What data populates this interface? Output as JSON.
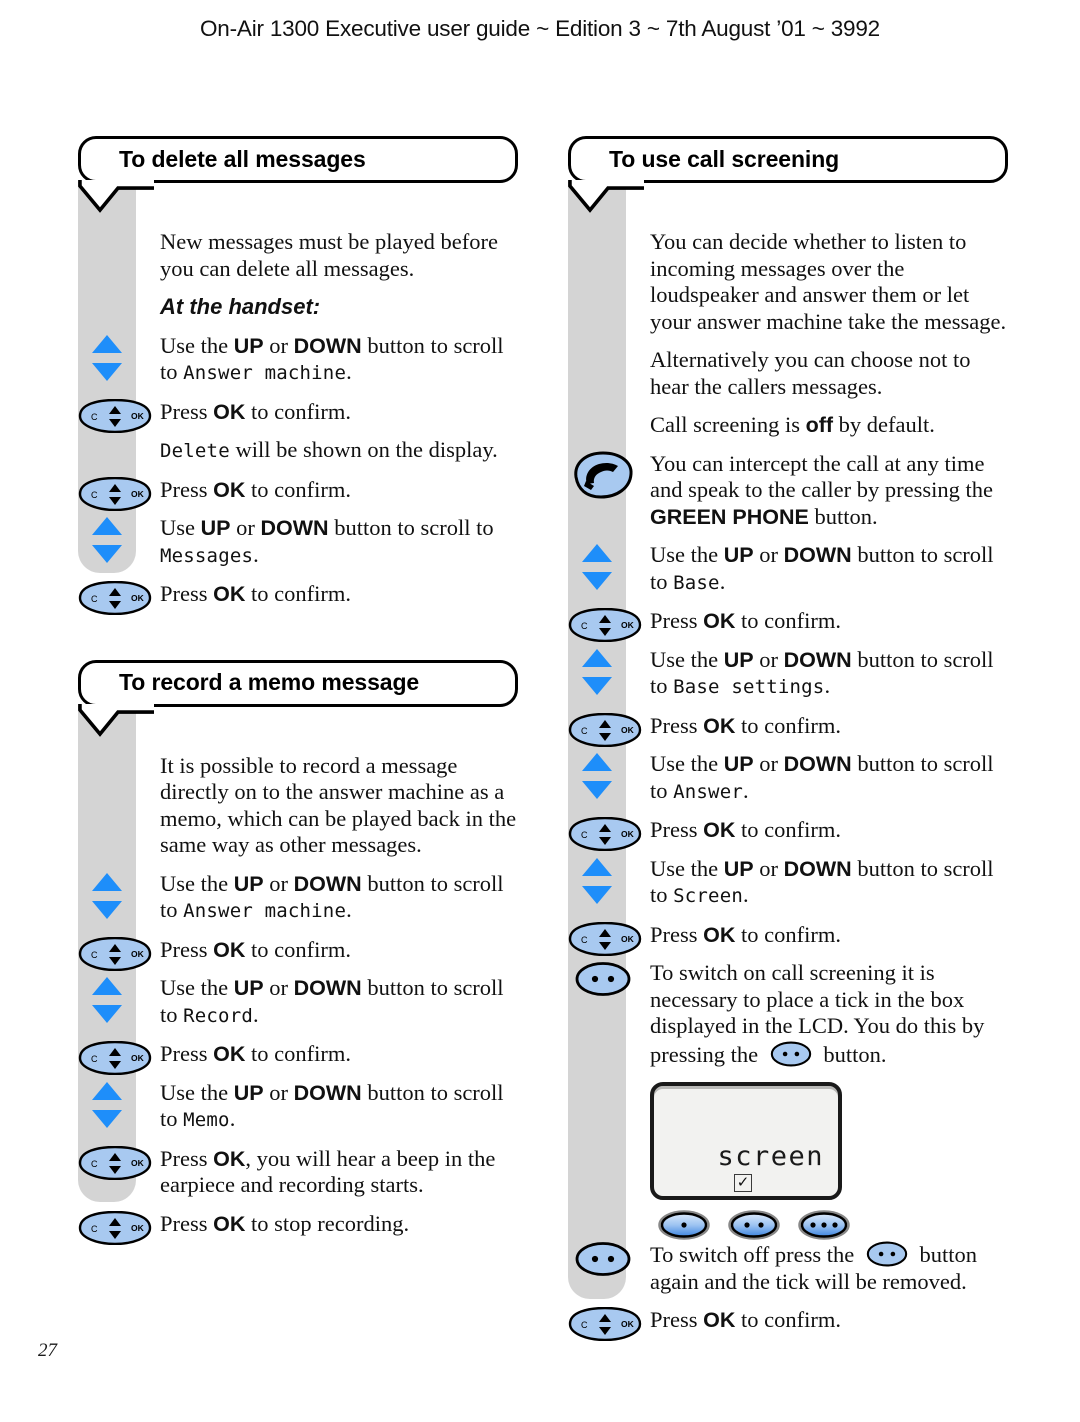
{
  "page": {
    "header": "On-Air 1300 Executive user guide ~ Edition 3 ~ 7th August ’01 ~ 3992",
    "number": "27"
  },
  "colors": {
    "rail_gray": "#d4d4d4",
    "arrow_blue": "#1e8efa",
    "button_blue": "#a8c9f0",
    "lcd_bg": "#f2f2f0",
    "outline": "#000000"
  },
  "icons": {
    "up_down": "up-down-arrows-icon",
    "ok_nav": "ok-navigation-button-icon",
    "green_phone": "green-phone-button-icon",
    "option": "option-two-dot-button-icon",
    "one_dot": "one-dot-button-icon",
    "two_dot": "two-dot-button-icon",
    "three_dot": "three-dot-button-icon"
  },
  "left_column": {
    "sections": [
      {
        "title": "To delete all messages",
        "rows": [
          {
            "icon": "none",
            "parts": [
              {
                "t": "plain",
                "v": "New messages must be played before you can delete all messages."
              }
            ]
          },
          {
            "icon": "none",
            "parts": [
              {
                "t": "headitalic",
                "v": "At the handset:"
              }
            ]
          },
          {
            "icon": "up_down",
            "parts": [
              {
                "t": "plain",
                "v": "Use the "
              },
              {
                "t": "bold",
                "v": "UP"
              },
              {
                "t": "plain",
                "v": " or "
              },
              {
                "t": "bold",
                "v": "DOWN"
              },
              {
                "t": "plain",
                "v": " button to scroll to "
              },
              {
                "t": "lcd",
                "v": "Answer machine"
              },
              {
                "t": "plain",
                "v": "."
              }
            ]
          },
          {
            "icon": "ok_nav",
            "parts": [
              {
                "t": "plain",
                "v": "Press "
              },
              {
                "t": "bold",
                "v": "OK"
              },
              {
                "t": "plain",
                "v": " to confirm."
              }
            ]
          },
          {
            "icon": "none",
            "parts": [
              {
                "t": "lcd",
                "v": "Delete"
              },
              {
                "t": "plain",
                "v": " will be shown on the display."
              }
            ]
          },
          {
            "icon": "ok_nav",
            "parts": [
              {
                "t": "plain",
                "v": "Press "
              },
              {
                "t": "bold",
                "v": "OK"
              },
              {
                "t": "plain",
                "v": " to confirm."
              }
            ]
          },
          {
            "icon": "up_down",
            "parts": [
              {
                "t": "plain",
                "v": "Use "
              },
              {
                "t": "bold",
                "v": "UP"
              },
              {
                "t": "plain",
                "v": " or "
              },
              {
                "t": "bold",
                "v": "DOWN"
              },
              {
                "t": "plain",
                "v": " button to scroll to "
              },
              {
                "t": "lcd",
                "v": "Messages"
              },
              {
                "t": "plain",
                "v": "."
              }
            ]
          },
          {
            "icon": "ok_nav",
            "parts": [
              {
                "t": "plain",
                "v": "Press "
              },
              {
                "t": "bold",
                "v": "OK"
              },
              {
                "t": "plain",
                "v": " to confirm."
              }
            ]
          }
        ]
      },
      {
        "title": "To record a memo message",
        "rows": [
          {
            "icon": "none",
            "parts": [
              {
                "t": "plain",
                "v": "It is possible to record a message directly on to the answer machine as a memo, which can be played back in the same way as other messages."
              }
            ]
          },
          {
            "icon": "up_down",
            "parts": [
              {
                "t": "plain",
                "v": "Use the "
              },
              {
                "t": "bold",
                "v": "UP"
              },
              {
                "t": "plain",
                "v": " or "
              },
              {
                "t": "bold",
                "v": "DOWN"
              },
              {
                "t": "plain",
                "v": " button to scroll to "
              },
              {
                "t": "lcd",
                "v": "Answer machine"
              },
              {
                "t": "plain",
                "v": "."
              }
            ]
          },
          {
            "icon": "ok_nav",
            "parts": [
              {
                "t": "plain",
                "v": "Press "
              },
              {
                "t": "bold",
                "v": "OK"
              },
              {
                "t": "plain",
                "v": " to confirm."
              }
            ]
          },
          {
            "icon": "up_down",
            "parts": [
              {
                "t": "plain",
                "v": "Use the "
              },
              {
                "t": "bold",
                "v": "UP"
              },
              {
                "t": "plain",
                "v": " or "
              },
              {
                "t": "bold",
                "v": "DOWN"
              },
              {
                "t": "plain",
                "v": " button to scroll to "
              },
              {
                "t": "lcd",
                "v": "Record"
              },
              {
                "t": "plain",
                "v": "."
              }
            ]
          },
          {
            "icon": "ok_nav",
            "parts": [
              {
                "t": "plain",
                "v": "Press "
              },
              {
                "t": "bold",
                "v": "OK"
              },
              {
                "t": "plain",
                "v": " to confirm."
              }
            ]
          },
          {
            "icon": "up_down",
            "parts": [
              {
                "t": "plain",
                "v": "Use the "
              },
              {
                "t": "bold",
                "v": "UP"
              },
              {
                "t": "plain",
                "v": " or "
              },
              {
                "t": "bold",
                "v": "DOWN"
              },
              {
                "t": "plain",
                "v": " button to scroll to "
              },
              {
                "t": "lcd",
                "v": "Memo"
              },
              {
                "t": "plain",
                "v": "."
              }
            ]
          },
          {
            "icon": "ok_nav",
            "parts": [
              {
                "t": "plain",
                "v": "Press "
              },
              {
                "t": "bold",
                "v": "OK"
              },
              {
                "t": "plain",
                "v": ", you will hear a beep in the earpiece and recording starts."
              }
            ]
          },
          {
            "icon": "ok_nav",
            "parts": [
              {
                "t": "plain",
                "v": "Press "
              },
              {
                "t": "bold",
                "v": "OK"
              },
              {
                "t": "plain",
                "v": " to stop recording."
              }
            ]
          }
        ]
      }
    ]
  },
  "right_column": {
    "sections": [
      {
        "title": "To use call screening",
        "rows": [
          {
            "icon": "none",
            "parts": [
              {
                "t": "plain",
                "v": "You can decide whether to listen to incoming messages over the loudspeaker and answer them or let your answer machine take the message."
              }
            ]
          },
          {
            "icon": "none",
            "parts": [
              {
                "t": "plain",
                "v": "Alternatively you can choose not to hear the callers messages."
              }
            ]
          },
          {
            "icon": "none",
            "parts": [
              {
                "t": "plain",
                "v": "Call screening is "
              },
              {
                "t": "bold",
                "v": "off"
              },
              {
                "t": "plain",
                "v": " by default."
              }
            ]
          },
          {
            "icon": "green_phone",
            "parts": [
              {
                "t": "plain",
                "v": "You can intercept the call at any time and speak to the caller by pressing the "
              },
              {
                "t": "bold",
                "v": "GREEN PHONE"
              },
              {
                "t": "plain",
                "v": " button."
              }
            ]
          },
          {
            "icon": "up_down",
            "parts": [
              {
                "t": "plain",
                "v": "Use the "
              },
              {
                "t": "bold",
                "v": "UP"
              },
              {
                "t": "plain",
                "v": " or "
              },
              {
                "t": "bold",
                "v": "DOWN"
              },
              {
                "t": "plain",
                "v": " button to scroll to "
              },
              {
                "t": "lcd",
                "v": "Base"
              },
              {
                "t": "plain",
                "v": "."
              }
            ]
          },
          {
            "icon": "ok_nav",
            "parts": [
              {
                "t": "plain",
                "v": "Press "
              },
              {
                "t": "bold",
                "v": "OK"
              },
              {
                "t": "plain",
                "v": " to confirm."
              }
            ]
          },
          {
            "icon": "up_down",
            "parts": [
              {
                "t": "plain",
                "v": "Use the "
              },
              {
                "t": "bold",
                "v": "UP"
              },
              {
                "t": "plain",
                "v": " or "
              },
              {
                "t": "bold",
                "v": "DOWN"
              },
              {
                "t": "plain",
                "v": " button to scroll to "
              },
              {
                "t": "lcd",
                "v": "Base settings"
              },
              {
                "t": "plain",
                "v": "."
              }
            ]
          },
          {
            "icon": "ok_nav",
            "parts": [
              {
                "t": "plain",
                "v": "Press "
              },
              {
                "t": "bold",
                "v": "OK"
              },
              {
                "t": "plain",
                "v": " to confirm."
              }
            ]
          },
          {
            "icon": "up_down",
            "parts": [
              {
                "t": "plain",
                "v": "Use the "
              },
              {
                "t": "bold",
                "v": "UP"
              },
              {
                "t": "plain",
                "v": " or "
              },
              {
                "t": "bold",
                "v": "DOWN"
              },
              {
                "t": "plain",
                "v": " button to scroll to "
              },
              {
                "t": "lcd",
                "v": "Answer"
              },
              {
                "t": "plain",
                "v": "."
              }
            ]
          },
          {
            "icon": "ok_nav",
            "parts": [
              {
                "t": "plain",
                "v": "Press "
              },
              {
                "t": "bold",
                "v": "OK"
              },
              {
                "t": "plain",
                "v": " to confirm."
              }
            ]
          },
          {
            "icon": "up_down",
            "parts": [
              {
                "t": "plain",
                "v": "Use the "
              },
              {
                "t": "bold",
                "v": "UP"
              },
              {
                "t": "plain",
                "v": " or "
              },
              {
                "t": "bold",
                "v": "DOWN"
              },
              {
                "t": "plain",
                "v": " button to scroll to "
              },
              {
                "t": "lcd",
                "v": "Screen"
              },
              {
                "t": "plain",
                "v": "."
              }
            ]
          },
          {
            "icon": "ok_nav",
            "parts": [
              {
                "t": "plain",
                "v": "Press "
              },
              {
                "t": "bold",
                "v": "OK"
              },
              {
                "t": "plain",
                "v": " to confirm."
              }
            ]
          },
          {
            "icon": "option",
            "parts": [
              {
                "t": "plain",
                "v": "To switch on call screening it is necessary to place a tick in the box displayed in the LCD. You do this by pressing the "
              },
              {
                "t": "optbtn",
                "v": "option-two-dot-button-icon"
              },
              {
                "t": "plain",
                "v": " button."
              }
            ]
          },
          {
            "icon": "figure",
            "parts": []
          },
          {
            "icon": "option",
            "parts": [
              {
                "t": "plain",
                "v": "To switch off press the "
              },
              {
                "t": "optbtn",
                "v": "option-two-dot-button-icon"
              },
              {
                "t": "plain",
                "v": " button again and the tick will be removed."
              }
            ]
          },
          {
            "icon": "ok_nav",
            "parts": [
              {
                "t": "plain",
                "v": "Press "
              },
              {
                "t": "bold",
                "v": "OK"
              },
              {
                "t": "plain",
                "v": " to confirm."
              }
            ]
          }
        ]
      }
    ]
  },
  "lcd_figure": {
    "display_text": "screen",
    "checkbox_state": "checked",
    "checkbox_glyph": "✓",
    "buttons": [
      {
        "name": "one-dot-button",
        "dots": 1
      },
      {
        "name": "two-dot-button",
        "dots": 2
      },
      {
        "name": "three-dot-button",
        "dots": 3
      }
    ]
  }
}
